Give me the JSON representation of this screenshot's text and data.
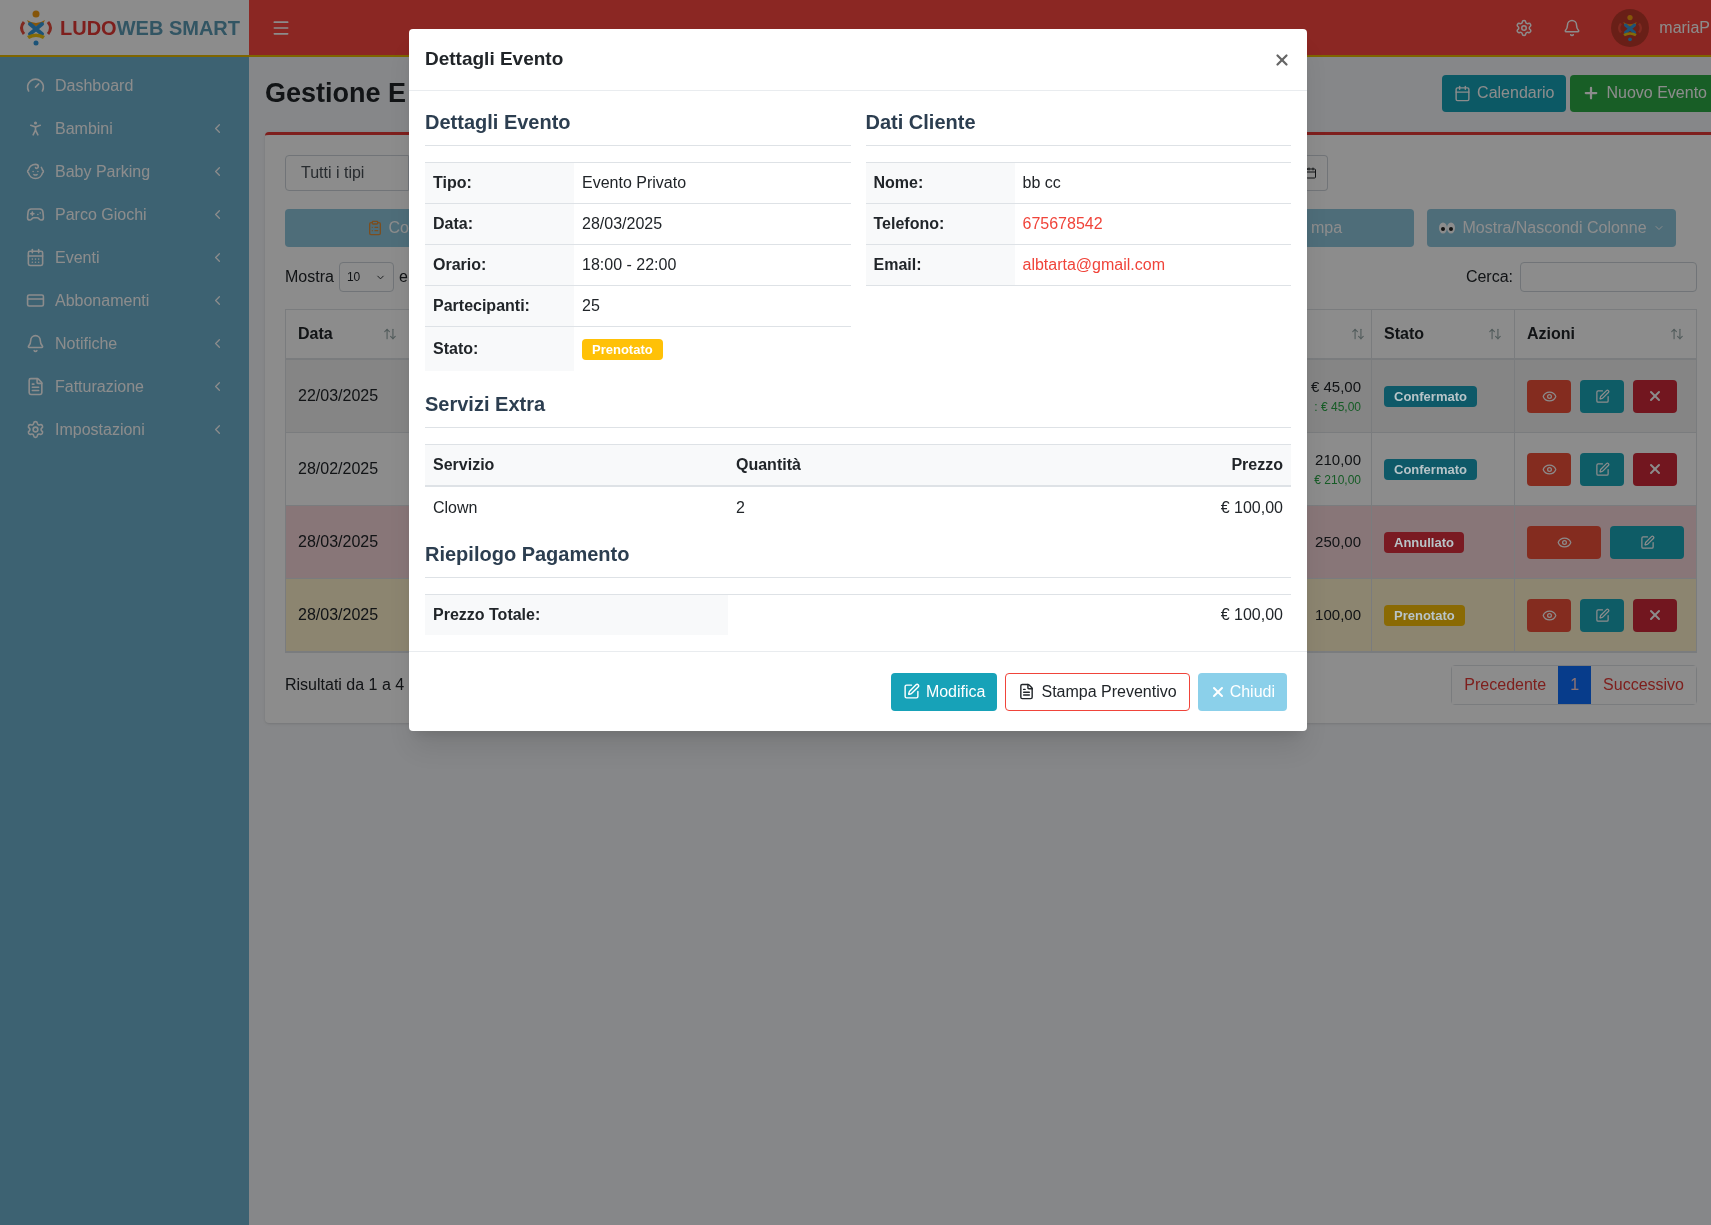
{
  "brand": {
    "part1": "LUDO",
    "part2": "WEB SMART"
  },
  "topbar": {
    "user": "mariaP"
  },
  "sidebar": {
    "items": [
      {
        "label": "Dashboard",
        "has_submenu": false
      },
      {
        "label": "Bambini",
        "has_submenu": true
      },
      {
        "label": "Baby Parking",
        "has_submenu": true
      },
      {
        "label": "Parco Giochi",
        "has_submenu": true
      },
      {
        "label": "Eventi",
        "has_submenu": true
      },
      {
        "label": "Abbonamenti",
        "has_submenu": true
      },
      {
        "label": "Notifiche",
        "has_submenu": true
      },
      {
        "label": "Fatturazione",
        "has_submenu": true
      },
      {
        "label": "Impostazioni",
        "has_submenu": true
      }
    ]
  },
  "page": {
    "title": "Gestione E",
    "buttons": [
      {
        "label": "Calendario",
        "kind": "calendar"
      },
      {
        "label": "Nuovo Evento",
        "kind": "new"
      }
    ]
  },
  "filters": {
    "type_select": "Tutti i tipi"
  },
  "toolbar": {
    "left_button": "Co",
    "right_buttons": [
      {
        "label": "mpa",
        "kind": "plain"
      },
      {
        "label": "Mostra/Nascondi Colonne",
        "kind": "columns"
      }
    ]
  },
  "length": {
    "label": "Mostra",
    "value": "10",
    "after": "e"
  },
  "search": {
    "label": "Cerca:"
  },
  "table": {
    "columns": [
      "Data",
      "Stato",
      "Azioni"
    ],
    "rows": [
      {
        "kind": "striped",
        "date": "22/03/2025",
        "amount": "€ 45,00",
        "paid": ": € 45,00",
        "status": {
          "label": "Confermato",
          "color": "#0e5968"
        },
        "actions": [
          {
            "kind": "view"
          },
          {
            "kind": "edit"
          },
          {
            "kind": "delete"
          }
        ]
      },
      {
        "kind": "plain",
        "date": "28/02/2025",
        "amount": "210,00",
        "paid": "€ 210,00",
        "status": {
          "label": "Confermato",
          "color": "#0e5968"
        },
        "actions": [
          {
            "kind": "view"
          },
          {
            "kind": "edit"
          },
          {
            "kind": "delete"
          }
        ]
      },
      {
        "kind": "danger",
        "date": "28/03/2025",
        "amount": "250,00",
        "status": {
          "label": "Annullato",
          "color": "#7a1a22"
        },
        "actions": [
          {
            "kind": "view"
          },
          {
            "kind": "edit"
          }
        ]
      },
      {
        "kind": "warning",
        "date": "28/03/2025",
        "amount": "100,00",
        "status": {
          "label": "Prenotato",
          "color": "#8a6a04"
        },
        "actions": [
          {
            "kind": "view"
          },
          {
            "kind": "edit"
          },
          {
            "kind": "delete"
          }
        ]
      }
    ]
  },
  "footer": {
    "info": "Risultati da 1 a 4",
    "pagination": [
      {
        "label": "Precedente",
        "selected": false
      },
      {
        "label": "1",
        "selected": true
      },
      {
        "label": "Successivo",
        "selected": false
      }
    ]
  },
  "modal": {
    "title": "Dettagli Evento",
    "event": {
      "title": "Dettagli Evento",
      "fields": [
        {
          "label": "Tipo:",
          "value": "Evento Privato",
          "kind": "text"
        },
        {
          "label": "Data:",
          "value": "28/03/2025",
          "kind": "text"
        },
        {
          "label": "Orario:",
          "value": "18:00 - 22:00",
          "kind": "text"
        },
        {
          "label": "Partecipanti:",
          "value": "25",
          "kind": "text"
        },
        {
          "label": "Stato:",
          "value": "Prenotato",
          "kind": "badge",
          "color": "#ffc107"
        }
      ]
    },
    "client": {
      "title": "Dati Cliente",
      "fields": [
        {
          "label": "Nome:",
          "value": "bb cc",
          "kind": "text"
        },
        {
          "label": "Telefono:",
          "value": "675678542",
          "kind": "link"
        },
        {
          "label": "Email:",
          "value": "albtarta@gmail.com",
          "kind": "link"
        }
      ]
    },
    "extras": {
      "title": "Servizi Extra",
      "columns": [
        "Servizio",
        "Quantità",
        "Prezzo"
      ],
      "rows": [
        [
          "Clown",
          "2",
          "€ 100,00"
        ]
      ]
    },
    "summary": {
      "title": "Riepilogo Pagamento",
      "label": "Prezzo Totale:",
      "value": "€ 100,00"
    },
    "buttons": [
      {
        "label": "Modifica",
        "kind": "edit"
      },
      {
        "label": "Stampa Preventivo",
        "kind": "print"
      },
      {
        "label": "Chiudi",
        "kind": "close"
      }
    ]
  }
}
